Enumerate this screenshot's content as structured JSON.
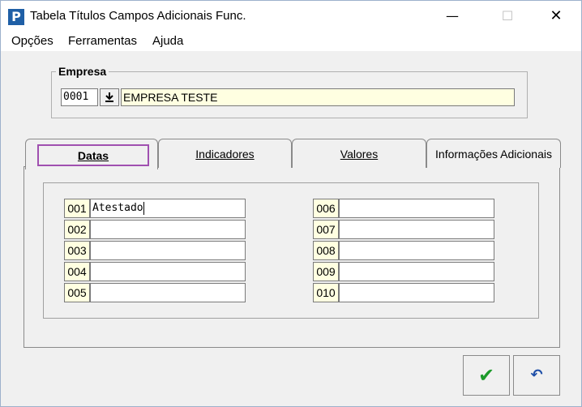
{
  "window": {
    "title": "Tabela Títulos Campos Adicionais Func.",
    "icon_letter": "P",
    "minimize_glyph": "—",
    "maximize_glyph": "☐",
    "close_glyph": "✕"
  },
  "menu": {
    "items": [
      {
        "label": "Opções"
      },
      {
        "label": "Ferramentas"
      },
      {
        "label": "Ajuda"
      }
    ]
  },
  "empresa": {
    "legend": "Empresa",
    "code": "0001",
    "name": "EMPRESA TESTE",
    "lookup_icon": "download-arrow-icon"
  },
  "tabs": [
    {
      "label": "Datas",
      "active": true
    },
    {
      "label": "Indicadores",
      "active": false
    },
    {
      "label": "Valores",
      "active": false
    },
    {
      "label": "Informações Adicionais",
      "active": false
    }
  ],
  "fields_left": [
    {
      "label": "001",
      "value": "Atestado"
    },
    {
      "label": "002",
      "value": ""
    },
    {
      "label": "003",
      "value": ""
    },
    {
      "label": "004",
      "value": ""
    },
    {
      "label": "005",
      "value": ""
    }
  ],
  "fields_right": [
    {
      "label": "006",
      "value": ""
    },
    {
      "label": "007",
      "value": ""
    },
    {
      "label": "008",
      "value": ""
    },
    {
      "label": "009",
      "value": ""
    },
    {
      "label": "010",
      "value": ""
    }
  ],
  "buttons": {
    "ok_icon": "✔",
    "undo_icon": "↶"
  },
  "colors": {
    "accent_focus": "#a050b0",
    "field_background": "#ffffe1",
    "ok_green": "#1c9a2a",
    "undo_blue": "#1f4fa8"
  }
}
